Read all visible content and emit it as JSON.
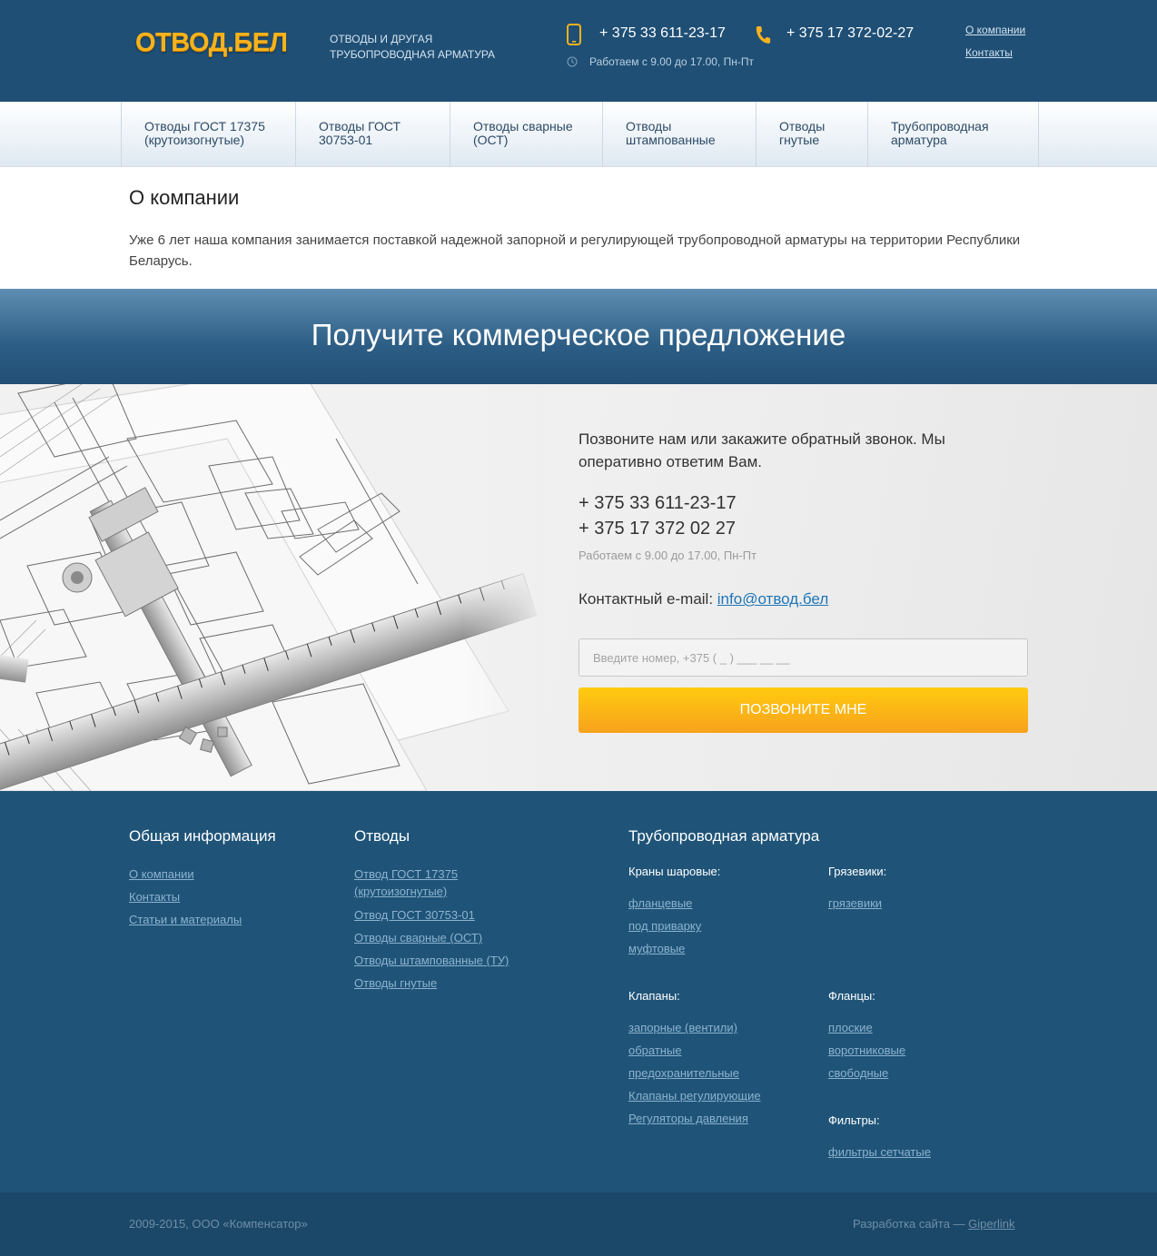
{
  "header": {
    "logo": "ОТВОД.БЕЛ",
    "tagline": "ОТВОДЫ И ДРУГАЯ ТРУБОПРОВОДНАЯ АРМАТУРА",
    "phone1": "+ 375 33 611-23-17",
    "phone2": "+ 375 17 372-02-27",
    "hours": "Работаем с 9.00 до 17.00, Пн-Пт",
    "links": [
      "О компании",
      "Контакты"
    ],
    "brand_color": "#f7b21c",
    "bg_color": "#1f4f75"
  },
  "nav": {
    "items": [
      "Отводы ГОСТ 17375 (крутоизогнутые)",
      "Отводы ГОСТ 30753-01",
      "Отводы сварные (ОСТ)",
      "Отводы штампованные",
      "Отводы гнутые",
      "Трубопроводная арматура"
    ]
  },
  "about": {
    "title": "О компании",
    "text": "Уже 6 лет наша компания занимается поставкой надежной запорной и регулирующей трубопроводной арматуры на территории Республики Беларусь."
  },
  "offer": {
    "title": "Получите коммерческое предложение"
  },
  "contact": {
    "text": "Позвоните нам или закажите обратный звонок. Мы оперативно ответим Вам.",
    "phone1": "+ 375 33 611-23-17",
    "phone2": "+ 375 17 372 02 27",
    "hours": "Работаем с 9.00 до 17.00, Пн-Пт",
    "email_label": "Контактный e-mail:",
    "email": "info@отвод.бел",
    "input_placeholder": "Введите номер, +375 ( _ ) ___ __ __",
    "button": "ПОЗВОНИТЕ МНЕ",
    "button_color": "#f8a21d"
  },
  "footer": {
    "general": {
      "title": "Общая информация",
      "links": [
        "О компании",
        "Контакты",
        "Статьи и материалы"
      ]
    },
    "bends": {
      "title": "Отводы",
      "links": [
        "Отвод ГОСТ 17375 (крутоизогнутые)",
        "Отвод ГОСТ 30753-01",
        "Отводы сварные (ОСТ)",
        "Отводы штампованные (ТУ)",
        "Отводы гнутые"
      ]
    },
    "fittings": {
      "title": "Трубопроводная арматура",
      "ball_valves": {
        "label": "Краны шаровые:",
        "links": [
          "фланцевые",
          "под приварку",
          "муфтовые"
        ]
      },
      "mud": {
        "label": "Грязевики:",
        "links": [
          "грязевики"
        ]
      },
      "valves": {
        "label": "Клапаны:",
        "links": [
          "запорные (вентили)",
          "обратные",
          "предохранительные",
          "Клапаны регулирующие",
          "Регуляторы давления"
        ]
      },
      "flanges": {
        "label": "Фланцы:",
        "links": [
          "плоские",
          "воротниковые",
          "свободные"
        ]
      },
      "filters": {
        "label": "Фильтры:",
        "links": [
          "фильтры сетчатые"
        ]
      }
    },
    "copyright": "2009-2015, ООО «Компенсатор»",
    "dev_label": "Разработка сайта —",
    "dev_link": "Giperlink"
  }
}
